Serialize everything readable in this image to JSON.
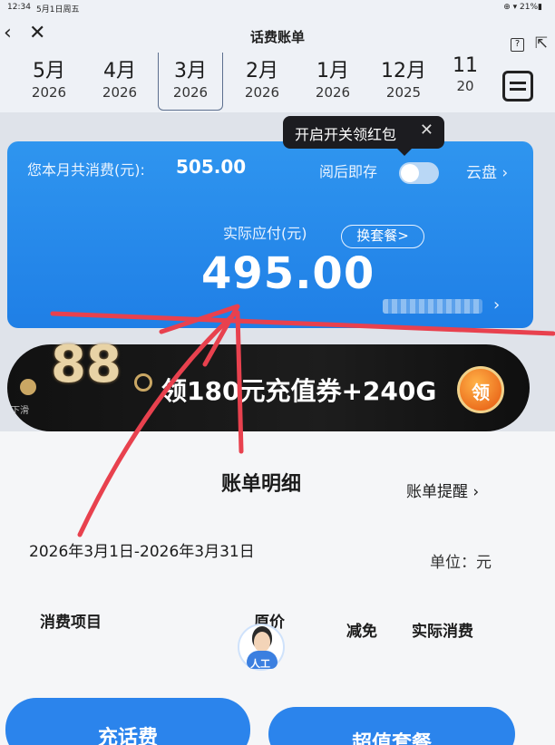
{
  "status_bar": {
    "time": "12:34",
    "date": "5月1日周五",
    "right": "⊕ ▾ 21%▮"
  },
  "header": {
    "title": "话费账单",
    "back_icon": "chevron-left-icon",
    "close_icon": "close-icon",
    "help_label": "?",
    "share_icon": "external-link-icon"
  },
  "months": [
    {
      "month": "5月",
      "year": "2026"
    },
    {
      "month": "4月",
      "year": "2026"
    },
    {
      "month": "3月",
      "year": "2026",
      "selected": true
    },
    {
      "month": "2月",
      "year": "2026"
    },
    {
      "month": "1月",
      "year": "2026"
    },
    {
      "month": "12月",
      "year": "2025"
    },
    {
      "month": "11",
      "year": "20"
    }
  ],
  "tooltip": {
    "text": "开启开关领红包",
    "close": "✕"
  },
  "bill_card": {
    "spent_label": "您本月共消费(元):",
    "spent_value": "505.00",
    "save_label": "阅后即存",
    "toggle_on": false,
    "cloud_label": "云盘 ›",
    "pay_label": "实际应付(元)",
    "change_plan_label": "换套餐>",
    "pay_value": "495.00",
    "chevron": "›"
  },
  "promo": {
    "badge": "88",
    "text": "领180元充值券+240G",
    "claim_label": "领",
    "small": "下滑"
  },
  "detail": {
    "title": "账单明细",
    "reminder_label": "账单提醒 ›",
    "date_range": "2026年3月1日-2026年3月31日",
    "unit": "单位：元",
    "columns": [
      "消费项目",
      "原价",
      "减免",
      "实际消费"
    ],
    "agent_label": "人工"
  },
  "buttons": {
    "recharge": "充话费",
    "plan": "超值套餐"
  },
  "colors": {
    "accent": "#2b84ec",
    "card": "#2f95ef",
    "annotation": "#e8414e"
  }
}
